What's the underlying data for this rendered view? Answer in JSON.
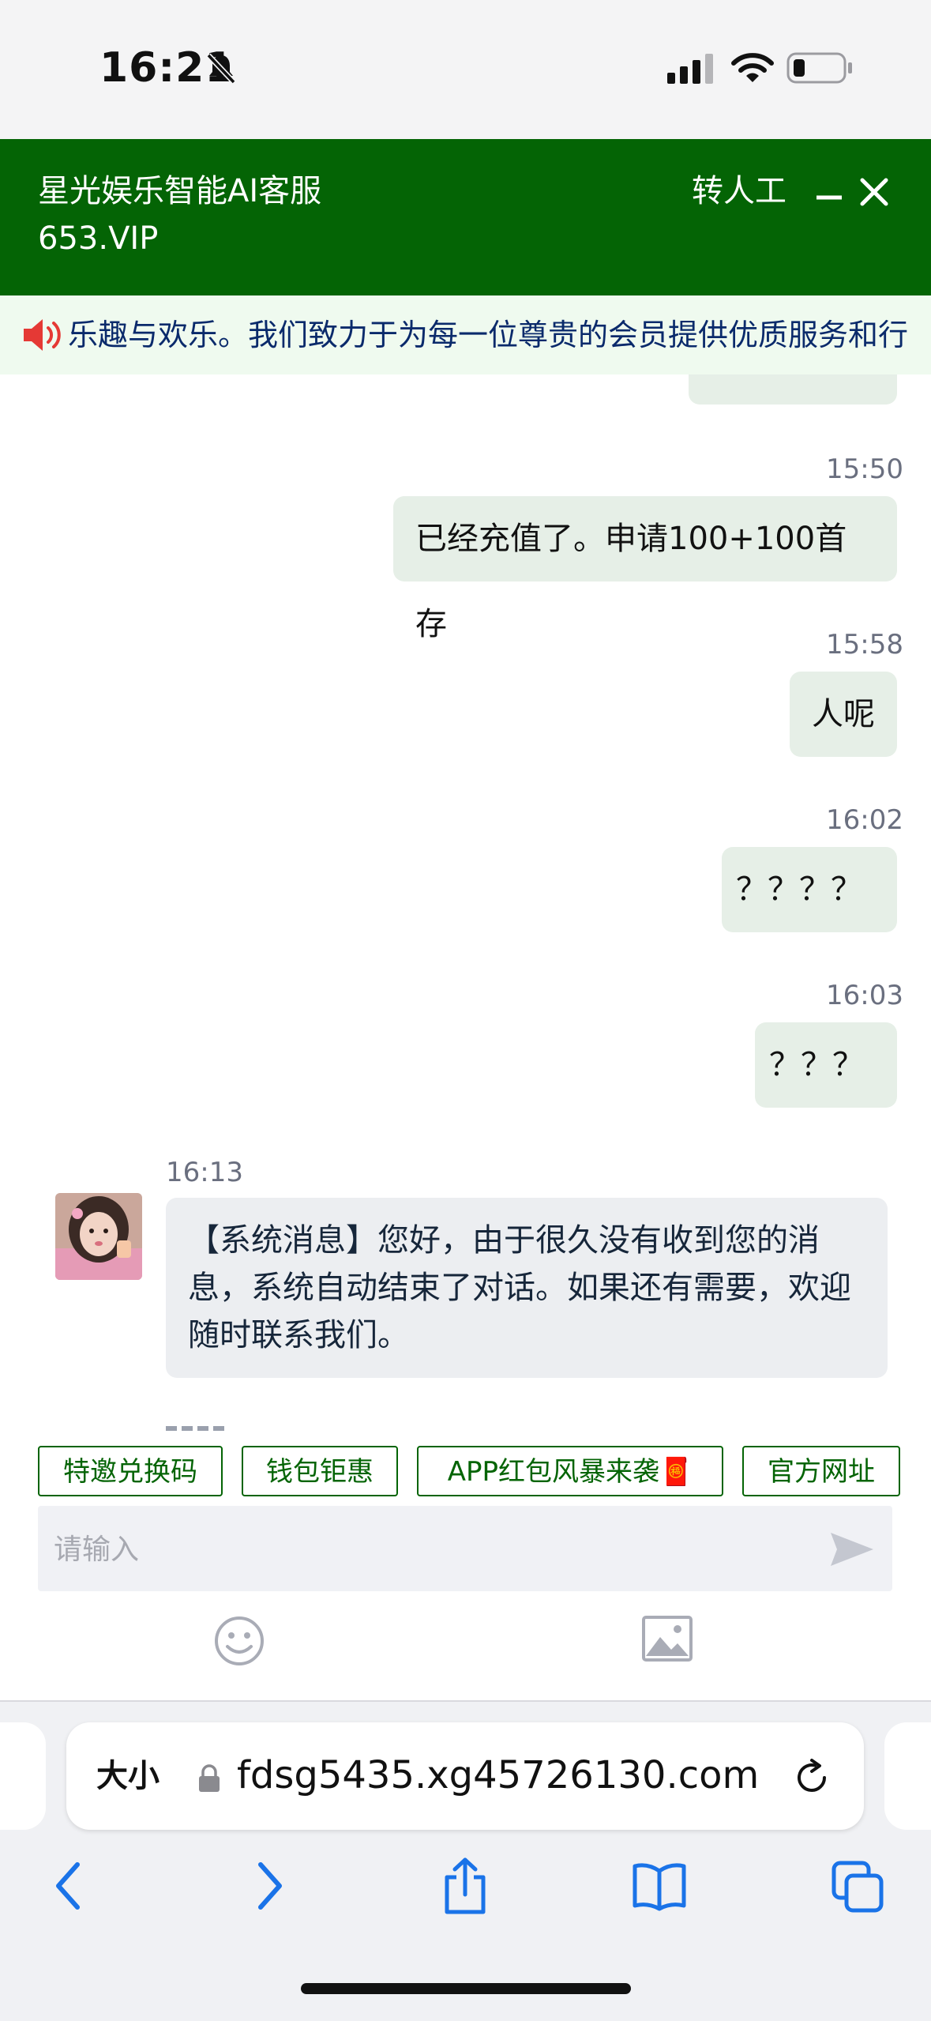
{
  "status_bar": {
    "time": "16:21"
  },
  "header": {
    "title": "星光娱乐智能AI客服",
    "subtitle": "653.VIP",
    "manual_label": "转人工"
  },
  "marquee": {
    "text": "乐趣与欢乐。我们致力于为每一位尊贵的会员提供优质服务和行"
  },
  "messages": [
    {
      "time": "15:50",
      "text": "已经充值了。申请100+100首存",
      "from": "user"
    },
    {
      "time": "15:58",
      "text": "人呢",
      "from": "user"
    },
    {
      "time": "16:02",
      "text": "？？？？",
      "from": "user"
    },
    {
      "time": "16:03",
      "text": "？？？",
      "from": "user"
    },
    {
      "time": "16:13",
      "text": "【系统消息】您好，由于很久没有收到您的消息，系统自动结束了对话。如果还有需要，欢迎随时联系我们。",
      "from": "system"
    }
  ],
  "quick_buttons": [
    "特邀兑换码",
    "钱包钜惠",
    "APP红包风暴来袭🧧",
    "官方网址"
  ],
  "input": {
    "placeholder": "请输入"
  },
  "browser": {
    "size_label": "大小",
    "url": "fdsg5435.xg45726130.com"
  },
  "colors": {
    "brand_green": "#046405",
    "bubble_out": "#e6efe7",
    "bubble_in": "#eceef1",
    "link_blue": "#1a73e8"
  }
}
